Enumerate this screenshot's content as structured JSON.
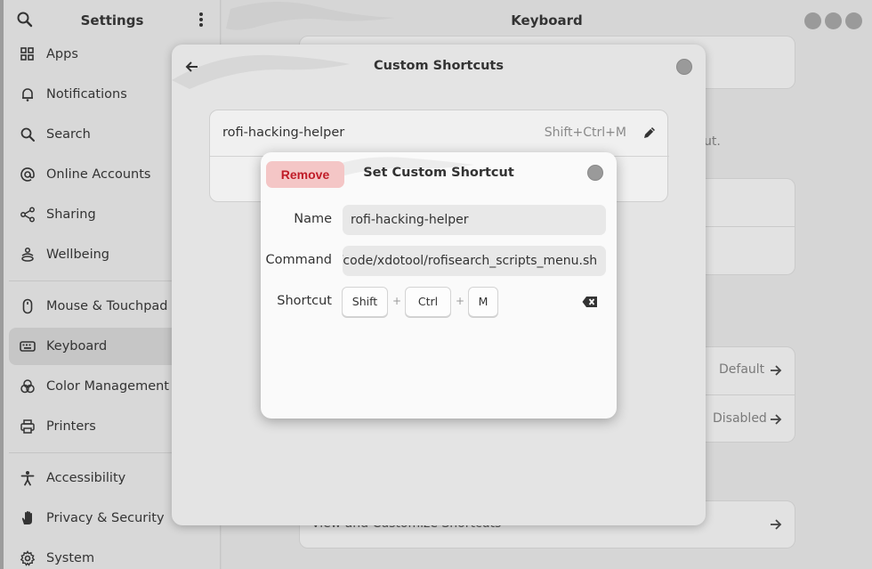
{
  "sidebar": {
    "title": "Settings",
    "items": [
      {
        "label": "Apps",
        "icon": "apps-grid-icon"
      },
      {
        "label": "Notifications",
        "icon": "bell-icon"
      },
      {
        "label": "Search",
        "icon": "search-icon"
      },
      {
        "label": "Online Accounts",
        "icon": "at-sign-icon"
      },
      {
        "label": "Sharing",
        "icon": "share-icon"
      },
      {
        "label": "Wellbeing",
        "icon": "wellbeing-icon"
      },
      {
        "label": "Mouse & Touchpad",
        "icon": "mouse-icon"
      },
      {
        "label": "Keyboard",
        "icon": "keyboard-icon",
        "active": true
      },
      {
        "label": "Color Management",
        "icon": "color-icon"
      },
      {
        "label": "Printers",
        "icon": "printer-icon"
      },
      {
        "label": "Accessibility",
        "icon": "accessibility-icon"
      },
      {
        "label": "Privacy & Security",
        "icon": "hand-icon"
      },
      {
        "label": "System",
        "icon": "gear-icon"
      }
    ]
  },
  "main": {
    "title": "Keyboard",
    "bg_fragment_text": "ut.",
    "bg_row_default": "Default",
    "bg_row_disabled": "Disabled",
    "bg_view_shortcuts": "View and Customize Shortcuts"
  },
  "custom_shortcuts": {
    "title": "Custom Shortcuts",
    "rows": [
      {
        "name": "rofi-hacking-helper",
        "accel": "Shift+Ctrl+M"
      }
    ]
  },
  "set_shortcut": {
    "remove_label": "Remove",
    "title": "Set Custom Shortcut",
    "name_label": "Name",
    "name_value": "rofi-hacking-helper",
    "command_label": "Command",
    "command_value": ":/code/xdotool/rofisearch_scripts_menu.sh",
    "shortcut_label": "Shortcut",
    "keys": [
      "Shift",
      "Ctrl",
      "M"
    ],
    "plus": "+"
  },
  "colors": {
    "destructive": "#c01c28",
    "destructive_bg": "#f4c6c6"
  }
}
